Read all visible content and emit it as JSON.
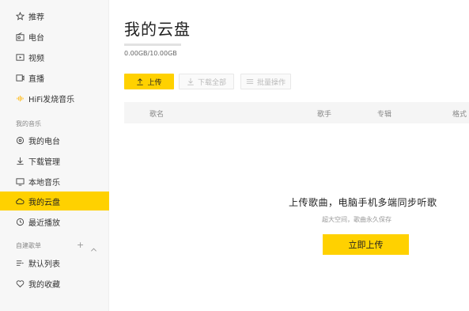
{
  "sidebar": {
    "top_items": [
      {
        "label": "推荐",
        "icon": "star-icon"
      },
      {
        "label": "电台",
        "icon": "radio-icon"
      },
      {
        "label": "视频",
        "icon": "video-icon"
      },
      {
        "label": "直播",
        "icon": "live-icon"
      },
      {
        "label": "HiFi发烧音乐",
        "icon": "hifi-icon"
      }
    ],
    "my_music_title": "我的音乐",
    "my_music_items": [
      {
        "label": "我的电台",
        "icon": "podcast-icon"
      },
      {
        "label": "下载管理",
        "icon": "download-icon"
      },
      {
        "label": "本地音乐",
        "icon": "monitor-icon"
      },
      {
        "label": "我的云盘",
        "icon": "cloud-icon",
        "active": true
      },
      {
        "label": "最近播放",
        "icon": "clock-icon"
      }
    ],
    "playlists_title": "自建歌单",
    "playlist_add": "+",
    "playlist_collapse": "^",
    "playlist_items": [
      {
        "label": "默认列表",
        "icon": "list-icon"
      },
      {
        "label": "我的收藏",
        "icon": "heart-icon"
      }
    ]
  },
  "main": {
    "title": "我的云盘",
    "storage": {
      "text": "0.00GB/10.00GB",
      "used_fraction": 0.0
    },
    "toolbar": {
      "upload_label": "上传",
      "download_all_label": "下载全部",
      "batch_label": "批量操作"
    },
    "table": {
      "columns": [
        "歌名",
        "歌手",
        "专辑",
        "格式"
      ]
    },
    "empty": {
      "title": "上传歌曲，电脑手机多端同步听歌",
      "subtitle": "超大空间，歌曲永久保存",
      "button_label": "立即上传"
    }
  },
  "colors": {
    "accent": "#ffd100",
    "sidebar_bg": "#f7f7f7"
  }
}
